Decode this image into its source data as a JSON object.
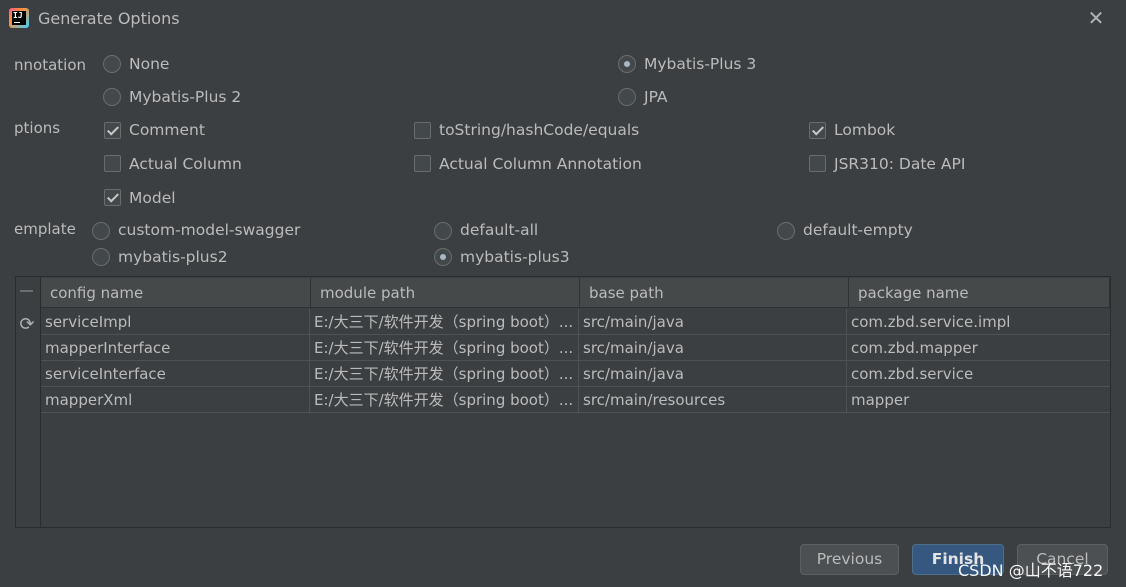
{
  "window": {
    "title": "Generate Options",
    "close_glyph": "✕",
    "app_icon": "intellij-idea-icon",
    "app_icon_text": "IJ"
  },
  "annotation": {
    "label": "nnotation",
    "options": [
      {
        "label": "None",
        "checked": false
      },
      {
        "label": "Mybatis-Plus 3",
        "checked": true
      },
      {
        "label": "Mybatis-Plus 2",
        "checked": false
      },
      {
        "label": "JPA",
        "checked": false
      }
    ]
  },
  "options": {
    "label": "ptions",
    "items": [
      {
        "label": "Comment",
        "checked": true
      },
      {
        "label": "toString/hashCode/equals",
        "checked": false
      },
      {
        "label": "Lombok",
        "checked": true
      },
      {
        "label": "Actual Column",
        "checked": false
      },
      {
        "label": "Actual Column Annotation",
        "checked": false
      },
      {
        "label": "JSR310: Date API",
        "checked": false
      },
      {
        "label": "Model",
        "checked": true
      }
    ]
  },
  "template": {
    "label": "emplate",
    "options": [
      {
        "label": "custom-model-swagger",
        "checked": false
      },
      {
        "label": "default-all",
        "checked": false
      },
      {
        "label": "default-empty",
        "checked": false
      },
      {
        "label": "mybatis-plus2",
        "checked": false
      },
      {
        "label": "mybatis-plus3",
        "checked": true
      }
    ]
  },
  "table": {
    "toolbar": {
      "remove_icon": "minus-icon",
      "refresh_icon": "refresh-icon",
      "refresh_glyph": "⟳"
    },
    "columns": [
      "config name",
      "module path",
      "base path",
      "package name"
    ],
    "rows": [
      [
        "serviceImpl",
        "E:/大三下/软件开发（spring boot）...",
        "src/main/java",
        "com.zbd.service.impl"
      ],
      [
        "mapperInterface",
        "E:/大三下/软件开发（spring boot）...",
        "src/main/java",
        "com.zbd.mapper"
      ],
      [
        "serviceInterface",
        "E:/大三下/软件开发（spring boot）...",
        "src/main/java",
        "com.zbd.service"
      ],
      [
        "mapperXml",
        "E:/大三下/软件开发（spring boot）...",
        "src/main/resources",
        "mapper"
      ]
    ]
  },
  "buttons": {
    "previous": "Previous",
    "finish": "Finish",
    "cancel": "Cancel"
  },
  "watermark": "CSDN @山不语722",
  "colors": {
    "background": "#3c3f41",
    "text": "#bbbbbb",
    "primary_button": "#365880",
    "header": "#45494a"
  }
}
